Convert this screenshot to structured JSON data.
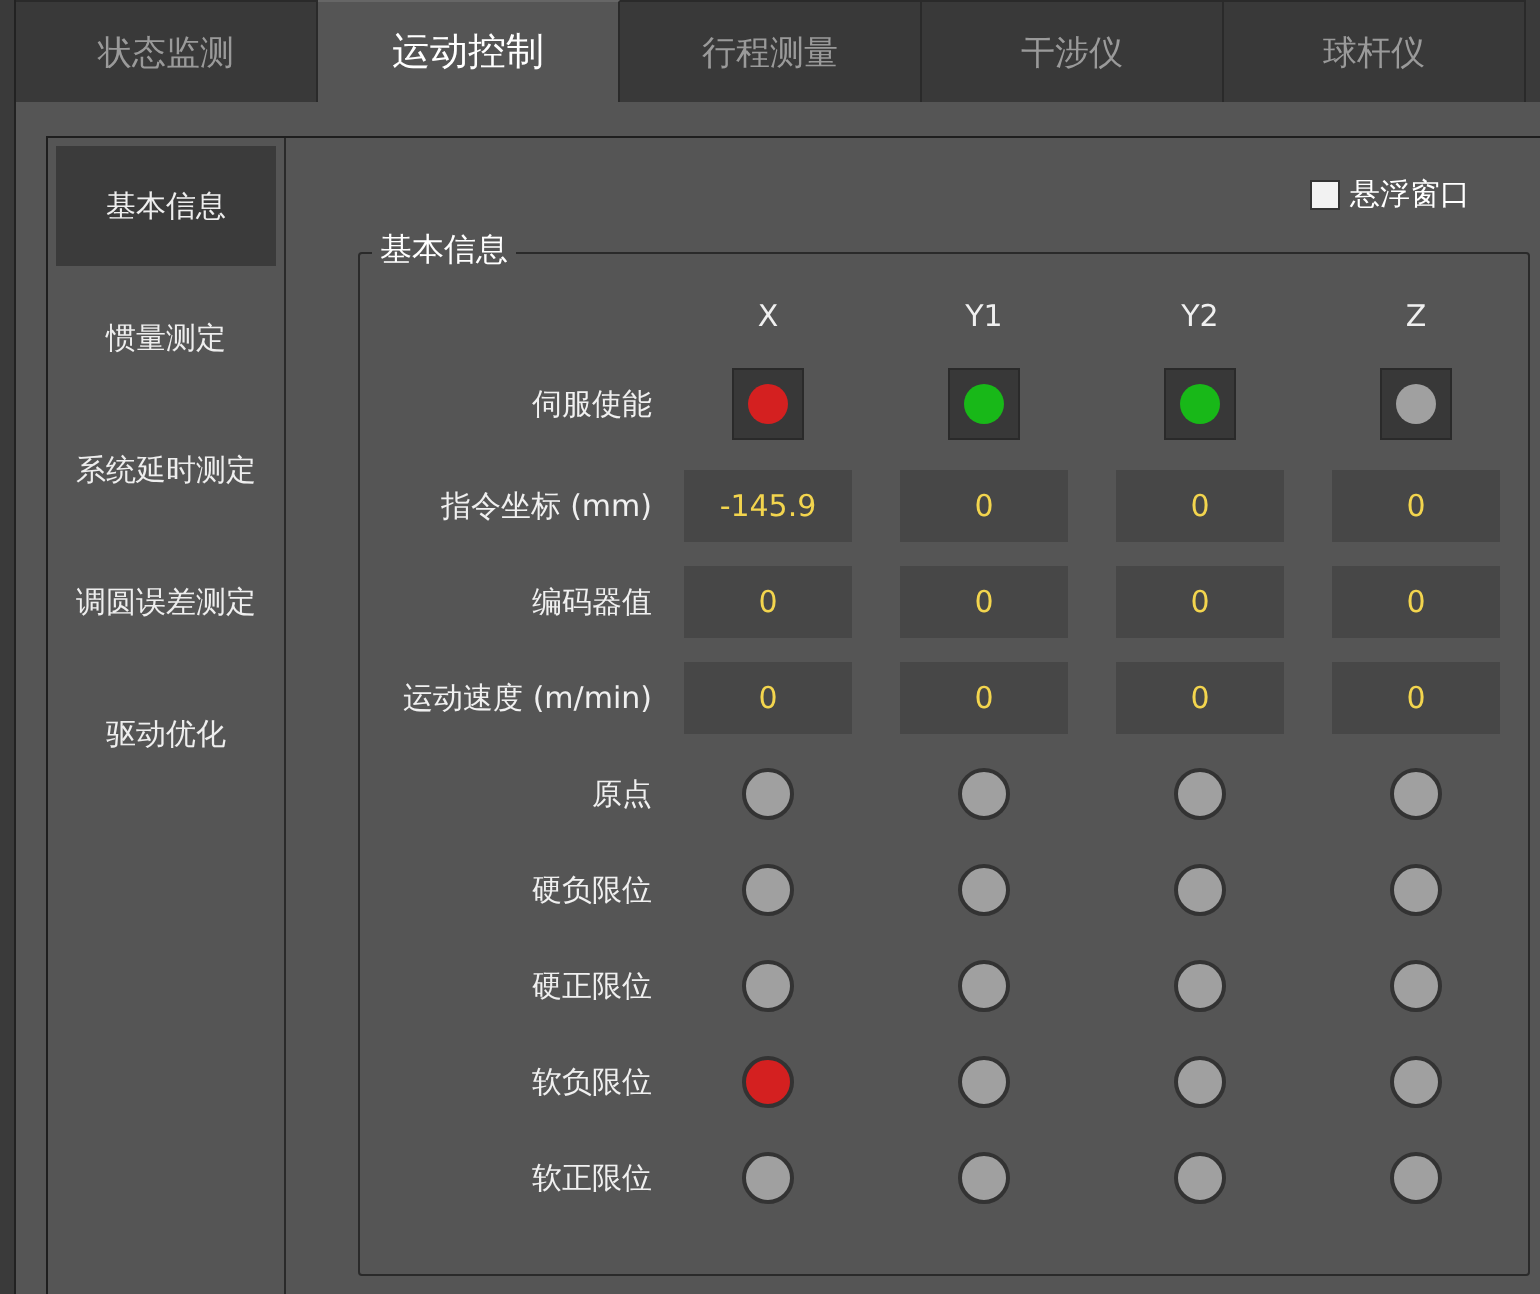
{
  "tabs": [
    {
      "label": "状态监测",
      "selected": false
    },
    {
      "label": "运动控制",
      "selected": true
    },
    {
      "label": "行程测量",
      "selected": false
    },
    {
      "label": "干涉仪",
      "selected": false
    },
    {
      "label": "球杆仪",
      "selected": false
    }
  ],
  "sidebar": {
    "items": [
      {
        "label": "基本信息",
        "selected": true
      },
      {
        "label": "惯量测定",
        "selected": false
      },
      {
        "label": "系统延时测定",
        "selected": false
      },
      {
        "label": "调圆误差测定",
        "selected": false
      },
      {
        "label": "驱动优化",
        "selected": false
      }
    ]
  },
  "float_window": {
    "label": "悬浮窗口",
    "checked": false
  },
  "group": {
    "title": "基本信息",
    "axes": [
      "X",
      "Y1",
      "Y2",
      "Z"
    ],
    "rows": [
      {
        "label": "伺服使能",
        "kind": "boxed-lamp",
        "cells": [
          {
            "color": "#d42020"
          },
          {
            "color": "#18b818"
          },
          {
            "color": "#18b818"
          },
          {
            "color": "#a0a0a0"
          }
        ]
      },
      {
        "label": "指令坐标 (mm)",
        "kind": "value",
        "cells": [
          {
            "value": "-145.9"
          },
          {
            "value": "0"
          },
          {
            "value": "0"
          },
          {
            "value": "0"
          }
        ]
      },
      {
        "label": "编码器值",
        "kind": "value",
        "cells": [
          {
            "value": "0"
          },
          {
            "value": "0"
          },
          {
            "value": "0"
          },
          {
            "value": "0"
          }
        ]
      },
      {
        "label": "运动速度 (m/min)",
        "kind": "value",
        "cells": [
          {
            "value": "0"
          },
          {
            "value": "0"
          },
          {
            "value": "0"
          },
          {
            "value": "0"
          }
        ]
      },
      {
        "label": "原点",
        "kind": "lamp",
        "cells": [
          {
            "color": "#a0a0a0"
          },
          {
            "color": "#a0a0a0"
          },
          {
            "color": "#a0a0a0"
          },
          {
            "color": "#a0a0a0"
          }
        ]
      },
      {
        "label": "硬负限位",
        "kind": "lamp",
        "cells": [
          {
            "color": "#a0a0a0"
          },
          {
            "color": "#a0a0a0"
          },
          {
            "color": "#a0a0a0"
          },
          {
            "color": "#a0a0a0"
          }
        ]
      },
      {
        "label": "硬正限位",
        "kind": "lamp",
        "cells": [
          {
            "color": "#a0a0a0"
          },
          {
            "color": "#a0a0a0"
          },
          {
            "color": "#a0a0a0"
          },
          {
            "color": "#a0a0a0"
          }
        ]
      },
      {
        "label": "软负限位",
        "kind": "lamp",
        "cells": [
          {
            "color": "#d42020"
          },
          {
            "color": "#a0a0a0"
          },
          {
            "color": "#a0a0a0"
          },
          {
            "color": "#a0a0a0"
          }
        ]
      },
      {
        "label": "软正限位",
        "kind": "lamp",
        "cells": [
          {
            "color": "#a0a0a0"
          },
          {
            "color": "#a0a0a0"
          },
          {
            "color": "#a0a0a0"
          },
          {
            "color": "#a0a0a0"
          }
        ]
      }
    ]
  }
}
